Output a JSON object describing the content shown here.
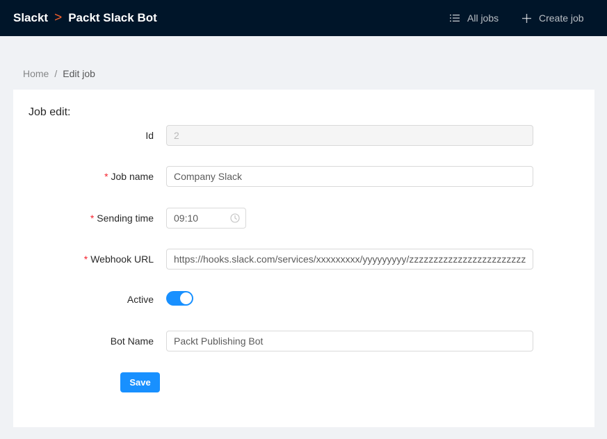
{
  "header": {
    "brand": "Slackt",
    "separator": ">",
    "project": "Packt Slack Bot",
    "nav": {
      "all_jobs": "All jobs",
      "create_job": "Create job"
    }
  },
  "breadcrumb": {
    "home": "Home",
    "separator": "/",
    "current": "Edit job"
  },
  "form": {
    "title": "Job edit:",
    "id": {
      "label": "Id",
      "value": "2"
    },
    "job_name": {
      "label": "Job name",
      "value": "Company Slack",
      "required_mark": "*"
    },
    "sending_time": {
      "label": "Sending time",
      "value": "09:10",
      "required_mark": "*"
    },
    "webhook_url": {
      "label": "Webhook URL",
      "value": "https://hooks.slack.com/services/xxxxxxxxx/yyyyyyyyy/zzzzzzzzzzzzzzzzzzzzzzzz",
      "required_mark": "*"
    },
    "active": {
      "label": "Active",
      "checked": true
    },
    "bot_name": {
      "label": "Bot Name",
      "value": "Packt Publishing Bot"
    },
    "save_label": "Save"
  },
  "colors": {
    "header_bg": "#001529",
    "accent": "#1890ff",
    "brand_separator": "#f5622d",
    "required": "#f5222d"
  },
  "icons": {
    "all_jobs": "list-icon",
    "create_job": "plus-icon",
    "time": "clock-icon"
  }
}
